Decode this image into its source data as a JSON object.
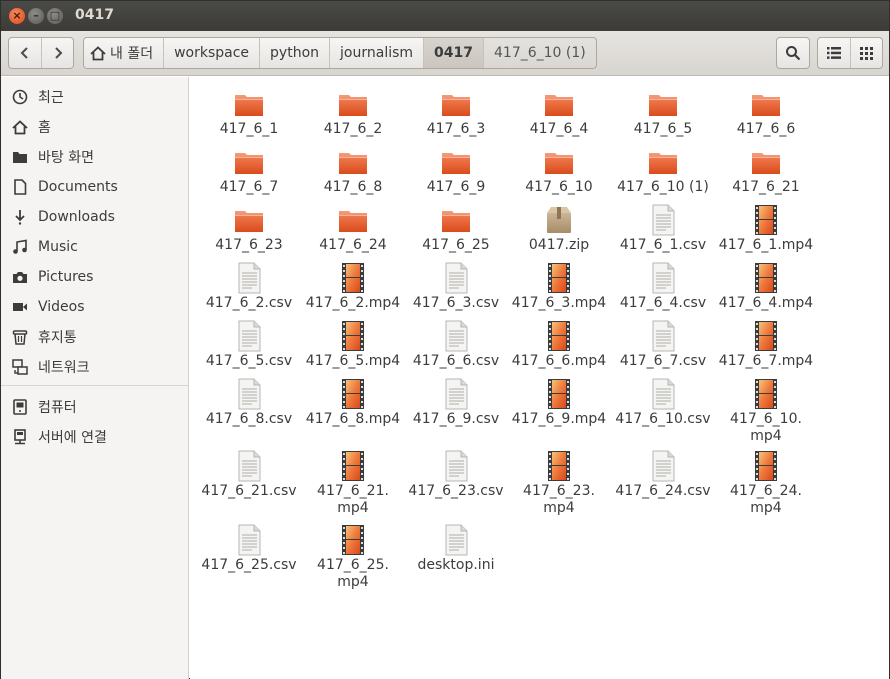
{
  "window": {
    "title": "0417"
  },
  "toolbar": {
    "back": "‹",
    "forward": "›",
    "breadcrumbs": [
      "내 폴더",
      "workspace",
      "python",
      "journalism",
      "0417",
      "417_6_10 (1)"
    ]
  },
  "sidebar": {
    "items": [
      {
        "label": "최근",
        "icon": "clock-icon"
      },
      {
        "label": "홈",
        "icon": "home-icon"
      },
      {
        "label": "바탕 화면",
        "icon": "folder-icon"
      },
      {
        "label": "Documents",
        "icon": "document-icon"
      },
      {
        "label": "Downloads",
        "icon": "download-icon"
      },
      {
        "label": "Music",
        "icon": "music-icon"
      },
      {
        "label": "Pictures",
        "icon": "camera-icon"
      },
      {
        "label": "Videos",
        "icon": "video-icon"
      },
      {
        "label": "휴지통",
        "icon": "trash-icon"
      },
      {
        "label": "네트워크",
        "icon": "network-icon"
      },
      {
        "label": "컴퓨터",
        "icon": "computer-icon"
      },
      {
        "label": "서버에 연결",
        "icon": "server-icon"
      }
    ]
  },
  "files": [
    {
      "name": "417_6_1",
      "type": "folder"
    },
    {
      "name": "417_6_2",
      "type": "folder"
    },
    {
      "name": "417_6_3",
      "type": "folder"
    },
    {
      "name": "417_6_4",
      "type": "folder"
    },
    {
      "name": "417_6_5",
      "type": "folder"
    },
    {
      "name": "417_6_6",
      "type": "folder"
    },
    {
      "name": "417_6_7",
      "type": "folder"
    },
    {
      "name": "417_6_8",
      "type": "folder"
    },
    {
      "name": "417_6_9",
      "type": "folder"
    },
    {
      "name": "417_6_10",
      "type": "folder"
    },
    {
      "name": "417_6_10 (1)",
      "type": "folder"
    },
    {
      "name": "417_6_21",
      "type": "folder"
    },
    {
      "name": "417_6_23",
      "type": "folder"
    },
    {
      "name": "417_6_24",
      "type": "folder"
    },
    {
      "name": "417_6_25",
      "type": "folder"
    },
    {
      "name": "0417.zip",
      "type": "archive"
    },
    {
      "name": "417_6_1.csv",
      "type": "text"
    },
    {
      "name": "417_6_1.mp4",
      "type": "video"
    },
    {
      "name": "417_6_2.csv",
      "type": "text"
    },
    {
      "name": "417_6_2.mp4",
      "type": "video"
    },
    {
      "name": "417_6_3.csv",
      "type": "text"
    },
    {
      "name": "417_6_3.mp4",
      "type": "video"
    },
    {
      "name": "417_6_4.csv",
      "type": "text"
    },
    {
      "name": "417_6_4.mp4",
      "type": "video"
    },
    {
      "name": "417_6_5.csv",
      "type": "text"
    },
    {
      "name": "417_6_5.mp4",
      "type": "video"
    },
    {
      "name": "417_6_6.csv",
      "type": "text"
    },
    {
      "name": "417_6_6.mp4",
      "type": "video"
    },
    {
      "name": "417_6_7.csv",
      "type": "text"
    },
    {
      "name": "417_6_7.mp4",
      "type": "video"
    },
    {
      "name": "417_6_8.csv",
      "type": "text"
    },
    {
      "name": "417_6_8.mp4",
      "type": "video"
    },
    {
      "name": "417_6_9.csv",
      "type": "text"
    },
    {
      "name": "417_6_9.mp4",
      "type": "video"
    },
    {
      "name": "417_6_10.csv",
      "type": "text"
    },
    {
      "name": "417_6_10.\nmp4",
      "type": "video"
    },
    {
      "name": "417_6_21.csv",
      "type": "text"
    },
    {
      "name": "417_6_21.\nmp4",
      "type": "video"
    },
    {
      "name": "417_6_23.csv",
      "type": "text"
    },
    {
      "name": "417_6_23.\nmp4",
      "type": "video"
    },
    {
      "name": "417_6_24.csv",
      "type": "text"
    },
    {
      "name": "417_6_24.\nmp4",
      "type": "video"
    },
    {
      "name": "417_6_25.csv",
      "type": "text"
    },
    {
      "name": "417_6_25.\nmp4",
      "type": "video"
    },
    {
      "name": "desktop.ini",
      "type": "text"
    }
  ],
  "colors": {
    "folder": "#e4572e",
    "accent": "#e95420"
  }
}
